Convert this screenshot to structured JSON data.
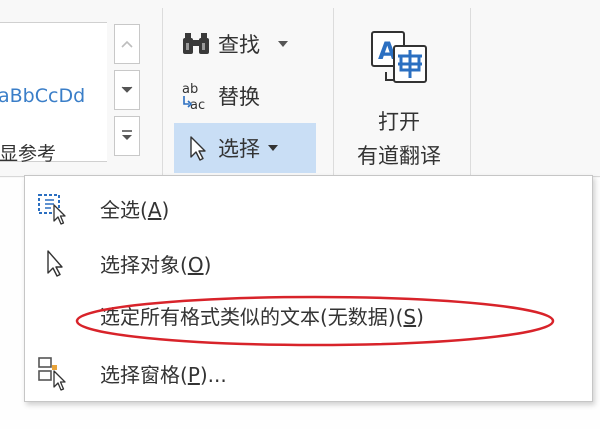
{
  "ribbon": {
    "styles": {
      "preview_text": "AaBbCcDd",
      "style_name": "显参考",
      "scroll_up_icon": "chevron-up-icon",
      "scroll_down_icon": "chevron-down-icon",
      "more_icon": "expand-gallery-icon"
    },
    "editing": {
      "find": {
        "label": "查找",
        "icon": "binoculars-icon",
        "has_dropdown": true
      },
      "replace": {
        "label": "替换",
        "icon": "replace-ab-ac-icon"
      },
      "select": {
        "label": "选择",
        "icon": "cursor-arrow-icon",
        "has_dropdown": true,
        "active": true
      }
    },
    "youdao": {
      "line1": "打开",
      "line2": "有道翻译",
      "icon": "translate-a-zh-icon"
    }
  },
  "select_menu": {
    "items": [
      {
        "text": "全选(",
        "key": "A",
        "tail": ")",
        "icon": "select-all-icon"
      },
      {
        "text": "选择对象(",
        "key": "O",
        "tail": ")",
        "icon": "cursor-arrow-icon"
      },
      {
        "text": "选定所有格式类似的文本(无数据)(",
        "key": "S",
        "tail": ")",
        "icon": "",
        "disabled": true
      },
      {
        "text": "选择窗格(",
        "key": "P",
        "tail": ")...",
        "icon": "selection-pane-icon"
      }
    ],
    "highlight": {
      "shape": "ellipse",
      "color": "#d8232a",
      "target": "item-3"
    }
  },
  "colors": {
    "accent_selected": "#c9def5",
    "style_preview": "#3a7ec8",
    "highlight": "#d8232a",
    "icon_blue": "#2b6fc1",
    "icon_orange": "#e8a33a"
  }
}
